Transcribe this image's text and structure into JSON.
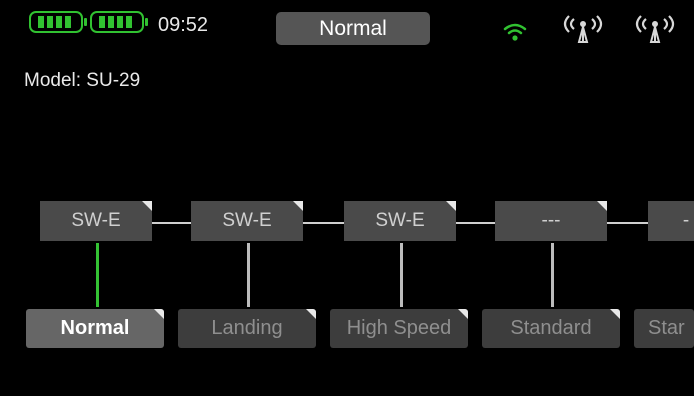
{
  "status_bar": {
    "time": "09:52",
    "flight_mode": "Normal",
    "icons": [
      "battery-icon",
      "battery-icon",
      "wifi-icon",
      "antenna-icon",
      "antenna-icon"
    ],
    "colors": {
      "battery": "#31c231",
      "wifi": "#31c231",
      "pill": "#555555"
    }
  },
  "model": {
    "label": "Model: SU-29"
  },
  "chain": {
    "switches": [
      "SW-E",
      "SW-E",
      "SW-E",
      "---",
      "-"
    ],
    "conditions": [
      {
        "label": "Normal",
        "active": true
      },
      {
        "label": "Landing",
        "active": false
      },
      {
        "label": "High Speed",
        "active": false
      },
      {
        "label": "Standard",
        "active": false
      },
      {
        "label": "Star",
        "active": false
      }
    ],
    "colors": {
      "active_link": "#34c234"
    }
  }
}
